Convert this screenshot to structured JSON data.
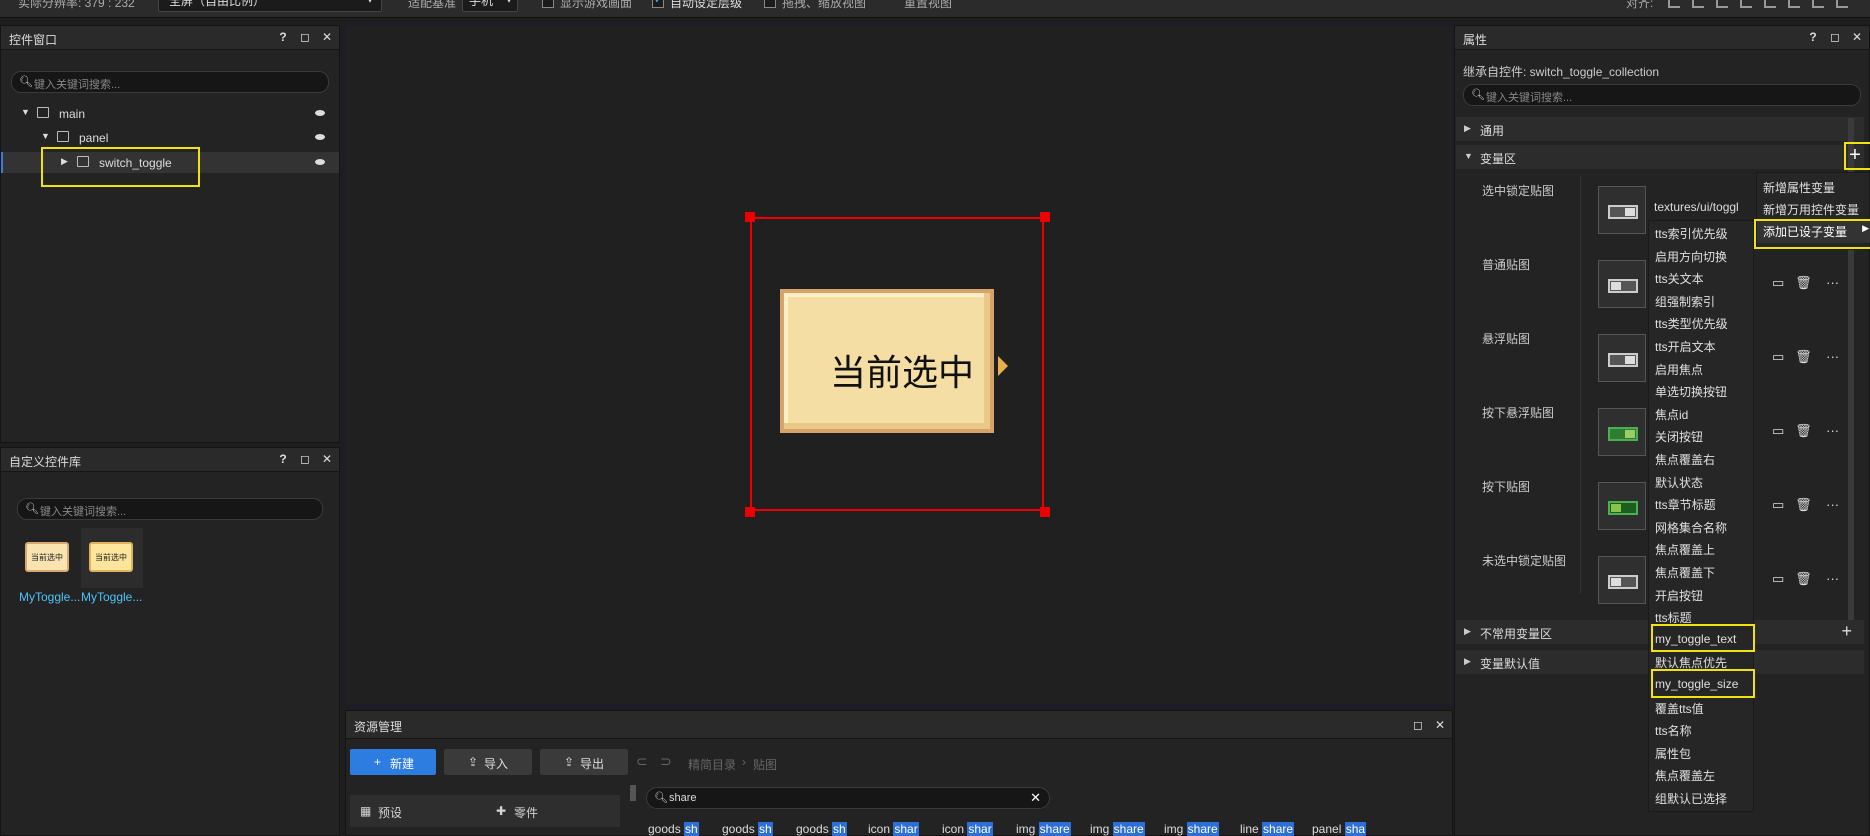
{
  "toolbar": {
    "resolution": "实际分辨率: 379 : 232",
    "screen_mode": "全屏（自由比例）",
    "adapt_label": "适配基准",
    "adapt_value": "手机",
    "show_game": "显示游戏画面",
    "auto_layer": "自动设定层级",
    "drag_zoom": "拖拽、缩放视图",
    "reset_view": "重置视图",
    "align_label": "对齐:"
  },
  "controls_panel": {
    "title": "控件窗口",
    "search_placeholder": "键入关键词搜索...",
    "tree": [
      {
        "label": "main"
      },
      {
        "label": "panel"
      },
      {
        "label": "switch_toggle"
      }
    ]
  },
  "custom_library": {
    "title": "自定义控件库",
    "search_placeholder": "键入关键词搜索...",
    "items": [
      {
        "thumb_text": "当前选中",
        "label": "MyToggle..."
      },
      {
        "thumb_text": "当前选中",
        "label": "MyToggle..."
      }
    ]
  },
  "canvas": {
    "toggle_text": "当前选中"
  },
  "resources": {
    "title": "资源管理",
    "new_btn": "新建",
    "import_btn": "导入",
    "export_btn": "导出",
    "path": "精简目录",
    "path_child": "贴图",
    "categories": [
      "预设",
      "零件"
    ],
    "search_value": "share",
    "chips": [
      {
        "pre": "goods ",
        "hl": "sh"
      },
      {
        "pre": "goods ",
        "hl": "sh"
      },
      {
        "pre": "goods ",
        "hl": "sh"
      },
      {
        "pre": "icon ",
        "hl": "shar"
      },
      {
        "pre": "icon ",
        "hl": "shar"
      },
      {
        "pre": "img ",
        "hl": "share"
      },
      {
        "pre": "img ",
        "hl": "share"
      },
      {
        "pre": "img ",
        "hl": "share"
      },
      {
        "pre": "line ",
        "hl": "share"
      },
      {
        "pre": "panel ",
        "hl": "sha"
      }
    ]
  },
  "properties": {
    "title": "属性",
    "inherit": "继承自控件: switch_toggle_collection",
    "search_placeholder": "键入关键词搜索...",
    "sections": {
      "general": "通用",
      "variables": "变量区",
      "uncommon": "不常用变量区",
      "defaults": "变量默认值"
    },
    "rows": [
      {
        "label": "选中锁定贴图",
        "value": "textures/ui/toggl"
      },
      {
        "label": "普通贴图"
      },
      {
        "label": "悬浮贴图"
      },
      {
        "label": "按下悬浮贴图"
      },
      {
        "label": "按下贴图"
      },
      {
        "label": "未选中锁定贴图"
      }
    ],
    "add_menu": [
      "新增属性变量",
      "新增万用控件变量",
      "添加已设子变量"
    ],
    "submenu": [
      "tts索引优先级",
      "启用方向切换",
      "tts关文本",
      "组强制索引",
      "tts类型优先级",
      "tts开启文本",
      "启用焦点",
      "单选切换按钮",
      "焦点id",
      "关闭按钮",
      "焦点覆盖右",
      "默认状态",
      "tts章节标题",
      "网格集合名称",
      "焦点覆盖上",
      "焦点覆盖下",
      "开启按钮",
      "tts标题",
      "my_toggle_text",
      "默认焦点优先",
      "my_toggle_size",
      "覆盖tts值",
      "tts名称",
      "属性包",
      "焦点覆盖左",
      "组默认已选择"
    ]
  }
}
